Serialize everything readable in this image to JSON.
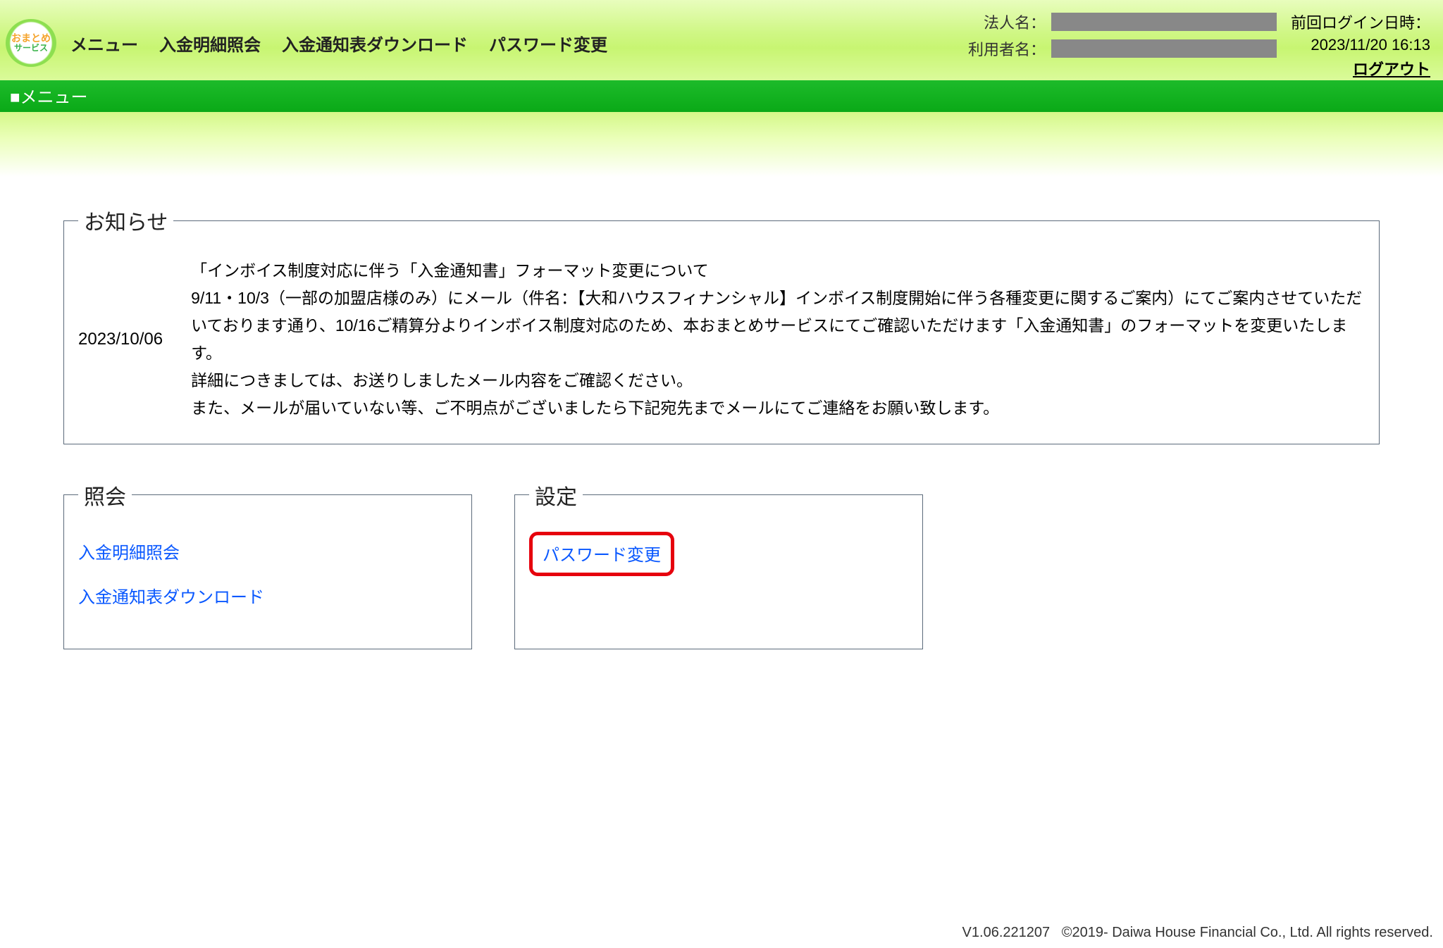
{
  "logo": {
    "line1": "おまとめ",
    "line2": "サービス"
  },
  "nav": {
    "menu": "メニュー",
    "deposit_detail": "入金明細照会",
    "deposit_download": "入金通知表ダウンロード",
    "password_change": "パスワード変更"
  },
  "header": {
    "corp_label": "法人名：",
    "user_label": "利用者名：",
    "last_login_label": "前回ログイン日時：",
    "last_login_value": "2023/11/20 16:13",
    "logout": "ログアウト"
  },
  "page_title": "■メニュー",
  "notice": {
    "legend": "お知らせ",
    "date": "2023/10/06",
    "body": "「インボイス制度対応に伴う「入金通知書」フォーマット変更について\n9/11・10/3（一部の加盟店様のみ）にメール（件名：【大和ハウスフィナンシャル】インボイス制度開始に伴う各種変更に関するご案内）にてご案内させていただいております通り、10/16ご精算分よりインボイス制度対応のため、本おまとめサービスにてご確認いただけます「入金通知書」のフォーマットを変更いたします。\n詳細につきましては、お送りしましたメール内容をご確認ください。\nまた、メールが届いていない等、ご不明点がございましたら下記宛先までメールにてご連絡をお願い致します。"
  },
  "inquiry": {
    "legend": "照会",
    "link1": "入金明細照会",
    "link2": "入金通知表ダウンロード"
  },
  "settings": {
    "legend": "設定",
    "link1": "パスワード変更"
  },
  "footer": {
    "version": "V1.06.221207",
    "copyright": "©2019- Daiwa House Financial Co., Ltd. All rights reserved."
  }
}
